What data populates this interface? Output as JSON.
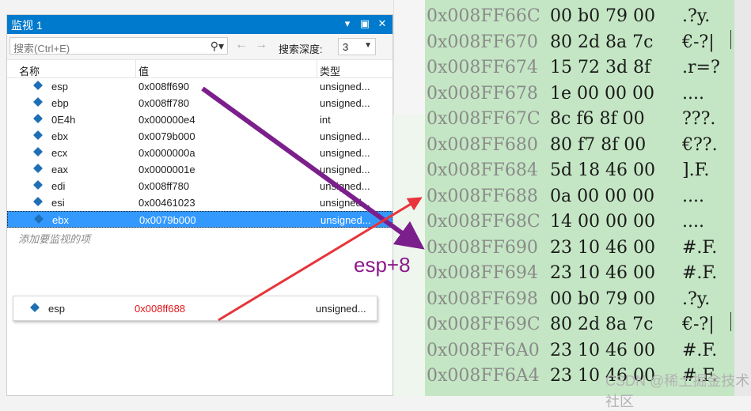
{
  "watch": {
    "title": "监视 1",
    "title_icons": [
      "chevron-down-icon",
      "restore-icon",
      "close-icon"
    ],
    "search_placeholder": "搜索(Ctrl+E)",
    "depth_label": "搜索深度:",
    "depth_value": "3",
    "columns": {
      "name": "名称",
      "value": "值",
      "type": "类型"
    },
    "rows": [
      {
        "name": "esp",
        "value": "0x008ff690",
        "type": "unsigned..."
      },
      {
        "name": "ebp",
        "value": "0x008ff780",
        "type": "unsigned..."
      },
      {
        "name": "0E4h",
        "value": "0x000000e4",
        "type": "int"
      },
      {
        "name": "ebx",
        "value": "0x0079b000",
        "type": "unsigned..."
      },
      {
        "name": "ecx",
        "value": "0x0000000a",
        "type": "unsigned..."
      },
      {
        "name": "eax",
        "value": "0x0000001e",
        "type": "unsigned..."
      },
      {
        "name": "edi",
        "value": "0x008ff780",
        "type": "unsigned..."
      },
      {
        "name": "esi",
        "value": "0x00461023",
        "type": "unsigned..."
      },
      {
        "name": "ebx",
        "value": "0x0079b000",
        "type": "unsigned..."
      }
    ],
    "add_hint": "添加要监视的项"
  },
  "popup": {
    "name": "esp",
    "value": "0x008ff688",
    "type": "unsigned..."
  },
  "memory": [
    {
      "addr": "0x008FF66C",
      "bytes": "00 b0 79 00",
      "ascii": ".?y."
    },
    {
      "addr": "0x008FF670",
      "bytes": "80 2d 8a 7c",
      "ascii": "€-?|"
    },
    {
      "addr": "0x008FF674",
      "bytes": "15 72 3d 8f",
      "ascii": ".r=?"
    },
    {
      "addr": "0x008FF678",
      "bytes": "1e 00 00 00",
      "ascii": "...."
    },
    {
      "addr": "0x008FF67C",
      "bytes": "8c f6 8f 00",
      "ascii": "???."
    },
    {
      "addr": "0x008FF680",
      "bytes": "80 f7 8f 00",
      "ascii": "€??."
    },
    {
      "addr": "0x008FF684",
      "bytes": "5d 18 46 00",
      "ascii": "].F."
    },
    {
      "addr": "0x008FF688",
      "bytes": "0a 00 00 00",
      "ascii": "...."
    },
    {
      "addr": "0x008FF68C",
      "bytes": "14 00 00 00",
      "ascii": "...."
    },
    {
      "addr": "0x008FF690",
      "bytes": "23 10 46 00",
      "ascii": "#.F."
    },
    {
      "addr": "0x008FF694",
      "bytes": "23 10 46 00",
      "ascii": "#.F."
    },
    {
      "addr": "0x008FF698",
      "bytes": "00 b0 79 00",
      "ascii": ".?y."
    },
    {
      "addr": "0x008FF69C",
      "bytes": "80 2d 8a 7c",
      "ascii": "€-?|"
    },
    {
      "addr": "0x008FF6A0",
      "bytes": "23 10 46 00",
      "ascii": "#.F."
    },
    {
      "addr": "0x008FF6A4",
      "bytes": "23 10 46 00",
      "ascii": "#.F."
    }
  ],
  "annotation": {
    "label": "esp+8",
    "purple": "#7b1f8c",
    "red": "#e8343a"
  },
  "watermark": "CSDN @稀土掘金技术社区"
}
